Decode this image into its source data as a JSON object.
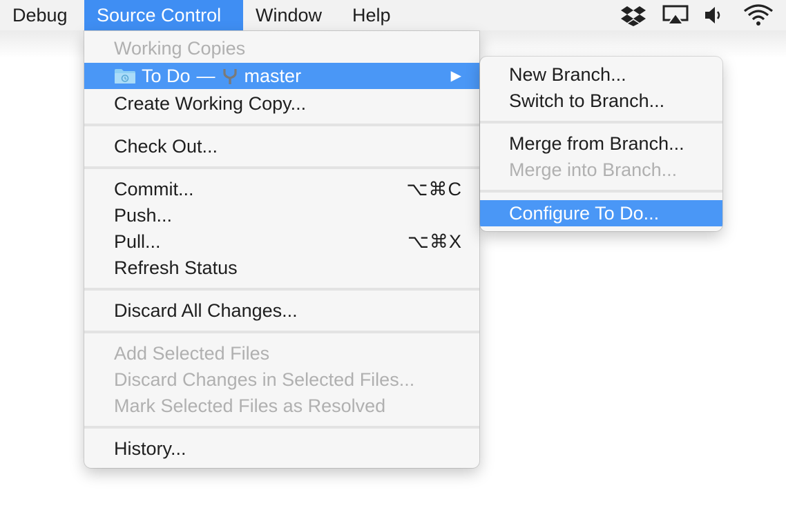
{
  "menubar": {
    "items": [
      "Debug",
      "Source Control",
      "Window",
      "Help"
    ],
    "active_index": 1,
    "status_icons": [
      "dropbox-icon",
      "airplay-icon",
      "volume-icon",
      "wifi-icon"
    ]
  },
  "source_control_menu": {
    "working_copies_header": "Working Copies",
    "todo_item": {
      "project": "To Do",
      "dash": "—",
      "branch": "master"
    },
    "create_working_copy": "Create Working Copy...",
    "check_out": "Check Out...",
    "commit": {
      "label": "Commit...",
      "shortcut": "⌥⌘C"
    },
    "push": "Push...",
    "pull": {
      "label": "Pull...",
      "shortcut": "⌥⌘X"
    },
    "refresh_status": "Refresh Status",
    "discard_all": "Discard All Changes...",
    "add_selected": "Add Selected Files",
    "discard_selected": "Discard Changes in Selected Files...",
    "mark_resolved": "Mark Selected Files as Resolved",
    "history": "History..."
  },
  "branch_submenu": {
    "new_branch": "New Branch...",
    "switch_branch": "Switch to Branch...",
    "merge_from": "Merge from Branch...",
    "merge_into": "Merge into Branch...",
    "configure": "Configure To Do..."
  },
  "colors": {
    "highlight": "#4a97f6",
    "menubar_active": "#3f8ef3",
    "disabled_text": "#b0b0b0"
  }
}
